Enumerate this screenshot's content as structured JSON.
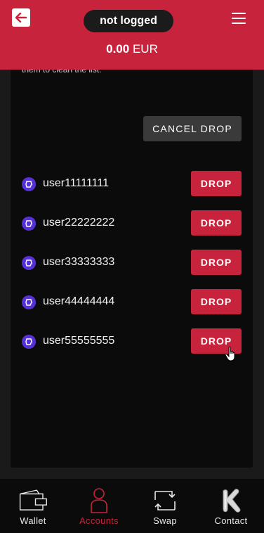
{
  "header": {
    "login_status": "not logged",
    "balance_amount": "0.00",
    "balance_currency": "EUR"
  },
  "card": {
    "description_partial": "them to clean the list.",
    "cancel_label": "CANCEL DROP",
    "accounts": [
      {
        "name": "user11111111",
        "drop_label": "DROP"
      },
      {
        "name": "user22222222",
        "drop_label": "DROP"
      },
      {
        "name": "user33333333",
        "drop_label": "DROP"
      },
      {
        "name": "user44444444",
        "drop_label": "DROP"
      },
      {
        "name": "user55555555",
        "drop_label": "DROP"
      }
    ]
  },
  "nav": {
    "items": [
      {
        "label": "Wallet",
        "icon": "wallet-icon",
        "active": false
      },
      {
        "label": "Accounts",
        "icon": "user-icon",
        "active": true
      },
      {
        "label": "Swap",
        "icon": "swap-icon",
        "active": false
      },
      {
        "label": "Contact",
        "icon": "k-logo-icon",
        "active": false
      }
    ]
  },
  "colors": {
    "accent": "#c8233c",
    "account_icon": "#5531d6",
    "card_bg": "#0b0b0b"
  }
}
